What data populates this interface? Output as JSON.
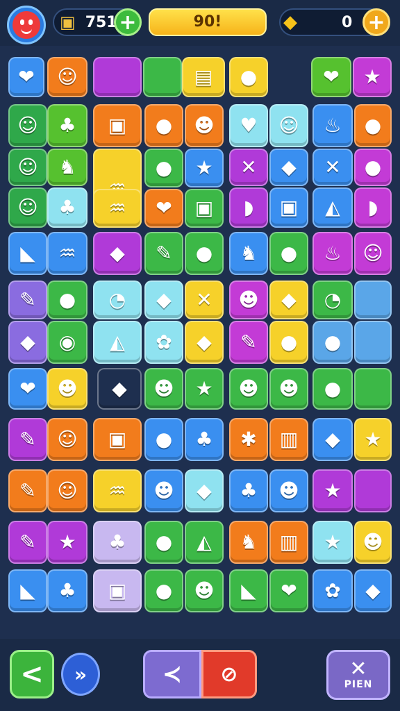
{
  "hud": {
    "avatar_icon": "smiley-face-icon",
    "coins_value": "751",
    "coins_icon": "treasure-icon",
    "score_value": "90!",
    "stars_value": "0",
    "stars_icon": "bird-icon",
    "add_symbol": "+"
  },
  "board": {
    "tiles": [
      {
        "icon": "heart-icon",
        "sym": "❤",
        "bg": "#3a8ff0"
      },
      {
        "icon": "creature-icon",
        "sym": "☺",
        "bg": "#f27c1c"
      },
      {
        "icon": "blank-tile",
        "sym": "",
        "bg": "#b03ad8"
      },
      {
        "icon": "blank-tile",
        "sym": "",
        "bg": "#3cb847"
      },
      {
        "icon": "treasure-box-icon",
        "sym": "▤",
        "bg": "#f6d12a"
      },
      {
        "icon": "red-face-icon",
        "sym": "●",
        "bg": "#f6d12a"
      },
      {
        "icon": "heart-icon",
        "sym": "❤",
        "bg": "#56c12f"
      },
      {
        "icon": "star-icon",
        "sym": "★",
        "bg": "#c33bd6"
      },
      {
        "icon": "smiley-icon",
        "sym": "☺",
        "bg": "#2fa84a"
      },
      {
        "icon": "leaf-icon",
        "sym": "♣",
        "bg": "#56c12f"
      },
      {
        "icon": "smiley-icon",
        "sym": "☺",
        "bg": "#2fa84a"
      },
      {
        "icon": "creature-icon",
        "sym": "♞",
        "bg": "#56c12f"
      },
      {
        "icon": "smiley-icon",
        "sym": "☺",
        "bg": "#2fa84a"
      },
      {
        "icon": "leaf-icon",
        "sym": "♣",
        "bg": "#8fe2f0"
      },
      {
        "icon": "gift-box-icon",
        "sym": "▣",
        "bg": "#f27c1c"
      },
      {
        "icon": "blob-icon",
        "sym": "●",
        "bg": "#f27c1c"
      },
      {
        "icon": "chick-icon",
        "sym": "☻",
        "bg": "#f27c1c"
      },
      {
        "icon": "fish-icon",
        "sym": "♒",
        "bg": "#f6d12a"
      },
      {
        "icon": "blob-icon",
        "sym": "●",
        "bg": "#3cb847"
      },
      {
        "icon": "star-icon",
        "sym": "★",
        "bg": "#3a8ff0"
      },
      {
        "icon": "fish-icon",
        "sym": "♒",
        "bg": "#f6d12a"
      },
      {
        "icon": "heart-icon",
        "sym": "❤",
        "bg": "#f27c1c"
      },
      {
        "icon": "gift-box-icon",
        "sym": "▣",
        "bg": "#3cb847"
      },
      {
        "icon": "bird-icon",
        "sym": "♥",
        "bg": "#8fe2f0"
      },
      {
        "icon": "face-icon",
        "sym": "☺",
        "bg": "#8fe2f0"
      },
      {
        "icon": "bow-icon",
        "sym": "✕",
        "bg": "#b03ad8"
      },
      {
        "icon": "drop-icon",
        "sym": "◆",
        "bg": "#3a8ff0"
      },
      {
        "icon": "candy-icon",
        "sym": "◗",
        "bg": "#b03ad8"
      },
      {
        "icon": "gift-box-icon",
        "sym": "▣",
        "bg": "#3a8ff0"
      },
      {
        "icon": "cake-icon",
        "sym": "♨",
        "bg": "#3a8ff0"
      },
      {
        "icon": "blob-icon",
        "sym": "●",
        "bg": "#f27c1c"
      },
      {
        "icon": "bow-icon",
        "sym": "✕",
        "bg": "#3a8ff0"
      },
      {
        "icon": "blob-icon",
        "sym": "●",
        "bg": "#c33bd6"
      },
      {
        "icon": "shoe-icon",
        "sym": "◭",
        "bg": "#3a8ff0"
      },
      {
        "icon": "candy-icon",
        "sym": "◗",
        "bg": "#c33bd6"
      },
      {
        "icon": "horn-icon",
        "sym": "◣",
        "bg": "#3a8ff0"
      },
      {
        "icon": "fish-icon",
        "sym": "♒",
        "bg": "#3a8ff0"
      },
      {
        "icon": "whale-icon",
        "sym": "◆",
        "bg": "#b03ad8"
      },
      {
        "icon": "pencil-icon",
        "sym": "✎",
        "bg": "#3cb847"
      },
      {
        "icon": "blob-icon",
        "sym": "●",
        "bg": "#3cb847"
      },
      {
        "icon": "bear-icon",
        "sym": "♞",
        "bg": "#3a8ff0"
      },
      {
        "icon": "blob-icon",
        "sym": "●",
        "bg": "#3cb847"
      },
      {
        "icon": "cake-icon",
        "sym": "♨",
        "bg": "#c33bd6"
      },
      {
        "icon": "smiley-icon",
        "sym": "☺",
        "bg": "#c33bd6"
      },
      {
        "icon": "brush-icon",
        "sym": "✎",
        "bg": "#8a6ce0"
      },
      {
        "icon": "blob-icon",
        "sym": "●",
        "bg": "#3cb847"
      },
      {
        "icon": "drop-icon",
        "sym": "◆",
        "bg": "#8a6ce0"
      },
      {
        "icon": "palette-icon",
        "sym": "◉",
        "bg": "#3cb847"
      },
      {
        "icon": "lollipop-icon",
        "sym": "◔",
        "bg": "#8fe2f0"
      },
      {
        "icon": "drop-icon",
        "sym": "◆",
        "bg": "#8fe2f0"
      },
      {
        "icon": "shoe-icon",
        "sym": "◭",
        "bg": "#8fe2f0"
      },
      {
        "icon": "flower-icon",
        "sym": "✿",
        "bg": "#8fe2f0"
      },
      {
        "icon": "bow-icon",
        "sym": "✕",
        "bg": "#f6d12a"
      },
      {
        "icon": "drop-icon",
        "sym": "◆",
        "bg": "#f6d12a"
      },
      {
        "icon": "creature-icon",
        "sym": "☻",
        "bg": "#c33bd6"
      },
      {
        "icon": "diamond-icon",
        "sym": "◆",
        "bg": "#f6d12a"
      },
      {
        "icon": "pencil-icon",
        "sym": "✎",
        "bg": "#c33bd6"
      },
      {
        "icon": "balloon-icon",
        "sym": "●",
        "bg": "#f6d12a"
      },
      {
        "icon": "lollipop-icon",
        "sym": "◔",
        "bg": "#3cb847"
      },
      {
        "icon": "blank-tile",
        "sym": "",
        "bg": "#5aa6e8"
      },
      {
        "icon": "ball-icon",
        "sym": "●",
        "bg": "#5aa6e8"
      },
      {
        "icon": "blank-tile",
        "sym": "",
        "bg": "#5aa6e8"
      },
      {
        "icon": "heart-icon",
        "sym": "❤",
        "bg": "#3a8ff0"
      },
      {
        "icon": "creature-icon",
        "sym": "☻",
        "bg": "#f6d12a"
      },
      {
        "icon": "whale-icon",
        "sym": "◆",
        "bg": "#1e2f4f"
      },
      {
        "icon": "creature-icon",
        "sym": "☻",
        "bg": "#3cb847"
      },
      {
        "icon": "star-icon",
        "sym": "★",
        "bg": "#3cb847"
      },
      {
        "icon": "creature-icon",
        "sym": "☻",
        "bg": "#3cb847"
      },
      {
        "icon": "creature-icon",
        "sym": "☻",
        "bg": "#3cb847"
      },
      {
        "icon": "blob-icon",
        "sym": "●",
        "bg": "#3cb847"
      },
      {
        "icon": "blank-tile",
        "sym": "",
        "bg": "#3cb847"
      },
      {
        "icon": "pencil-icon",
        "sym": "✎",
        "bg": "#b03ad8"
      },
      {
        "icon": "ghost-icon",
        "sym": "☺",
        "bg": "#f27c1c"
      },
      {
        "icon": "gift-box-icon",
        "sym": "▣",
        "bg": "#f27c1c"
      },
      {
        "icon": "blob-icon",
        "sym": "●",
        "bg": "#3a8ff0"
      },
      {
        "icon": "leaf-icon",
        "sym": "♣",
        "bg": "#3a8ff0"
      },
      {
        "icon": "cookie-icon",
        "sym": "✱",
        "bg": "#f27c1c"
      },
      {
        "icon": "jar-icon",
        "sym": "▥",
        "bg": "#f27c1c"
      },
      {
        "icon": "gem-icon",
        "sym": "◆",
        "bg": "#3a8ff0"
      },
      {
        "icon": "star-icon",
        "sym": "★",
        "bg": "#f6d12a"
      },
      {
        "icon": "pencil-icon",
        "sym": "✎",
        "bg": "#f27c1c"
      },
      {
        "icon": "ghost-icon",
        "sym": "☺",
        "bg": "#f27c1c"
      },
      {
        "icon": "fish-icon",
        "sym": "♒",
        "bg": "#f6d12a"
      },
      {
        "icon": "creature-icon",
        "sym": "☻",
        "bg": "#3a8ff0"
      },
      {
        "icon": "whale-icon",
        "sym": "◆",
        "bg": "#8fe2f0"
      },
      {
        "icon": "leaf-icon",
        "sym": "♣",
        "bg": "#3a8ff0"
      },
      {
        "icon": "creature-icon",
        "sym": "☻",
        "bg": "#3a8ff0"
      },
      {
        "icon": "star-icon",
        "sym": "★",
        "bg": "#b03ad8"
      },
      {
        "icon": "blank-tile",
        "sym": "",
        "bg": "#b03ad8"
      },
      {
        "icon": "pencil-icon",
        "sym": "✎",
        "bg": "#b03ad8"
      },
      {
        "icon": "star-icon",
        "sym": "★",
        "bg": "#b03ad8"
      },
      {
        "icon": "leaf-icon",
        "sym": "♣",
        "bg": "#c8b8f0"
      },
      {
        "icon": "lemon-icon",
        "sym": "●",
        "bg": "#3cb847"
      },
      {
        "icon": "shoe-icon",
        "sym": "◭",
        "bg": "#3cb847"
      },
      {
        "icon": "cat-icon",
        "sym": "♞",
        "bg": "#f27c1c"
      },
      {
        "icon": "jar-icon",
        "sym": "▥",
        "bg": "#f27c1c"
      },
      {
        "icon": "star-icon",
        "sym": "★",
        "bg": "#8fe2f0"
      },
      {
        "icon": "creature-icon",
        "sym": "☻",
        "bg": "#f6d12a"
      },
      {
        "icon": "horn-icon",
        "sym": "◣",
        "bg": "#3a8ff0"
      },
      {
        "icon": "leaf-icon",
        "sym": "♣",
        "bg": "#3a8ff0"
      },
      {
        "icon": "gift-box-icon",
        "sym": "▣",
        "bg": "#c8b8f0"
      },
      {
        "icon": "blob-icon",
        "sym": "●",
        "bg": "#3cb847"
      },
      {
        "icon": "creature-icon",
        "sym": "☻",
        "bg": "#3cb847"
      },
      {
        "icon": "horn-icon",
        "sym": "◣",
        "bg": "#3cb847"
      },
      {
        "icon": "heart-icon",
        "sym": "❤",
        "bg": "#3cb847"
      },
      {
        "icon": "flower-icon",
        "sym": "✿",
        "bg": "#3a8ff0"
      },
      {
        "icon": "gem-icon",
        "sym": "◆",
        "bg": "#3a8ff0"
      }
    ]
  },
  "controls": {
    "back_symbol": "<",
    "back_icon": "back-arrow-icon",
    "forward_symbol": "»",
    "forward_icon": "fast-forward-icon",
    "share_symbol": "≺",
    "share_icon": "share-icon",
    "hint_symbol": "⊘",
    "hint_icon": "magnifier-icon",
    "close_symbol": "✕",
    "close_label": "PIEN",
    "close_icon": "close-icon"
  }
}
